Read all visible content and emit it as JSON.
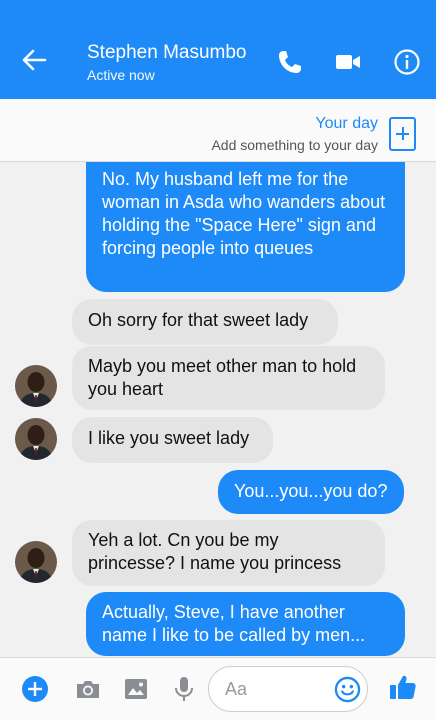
{
  "header": {
    "contact_name": "Stephen Masumbo",
    "status": "Active now"
  },
  "your_day": {
    "title": "Your day",
    "subtitle": "Add something to your day"
  },
  "messages": [
    {
      "sender": "me",
      "text": "No. My husband left me for the woman in Asda who wanders about holding the \"Space Here\" sign and forcing people into queues"
    },
    {
      "sender": "them",
      "text": "Oh sorry for that sweet lady"
    },
    {
      "sender": "them",
      "text": "Mayb you meet other man to hold you heart"
    },
    {
      "sender": "them",
      "text": "I like you sweet lady"
    },
    {
      "sender": "me",
      "text": "You...you...you do?"
    },
    {
      "sender": "them",
      "text": "Yeh a lot. Cn you be my princesse? I name you princess"
    },
    {
      "sender": "me",
      "text": "Actually, Steve, I have another name I like to be called by men..."
    }
  ],
  "composer": {
    "placeholder": "Aa"
  },
  "colors": {
    "accent": "#1e8af7",
    "incoming_bubble": "#e4e4e4",
    "background": "#f1f1f1"
  },
  "icons": [
    "back-arrow-icon",
    "phone-icon",
    "video-camera-icon",
    "info-icon",
    "add-story-icon",
    "plus-icon",
    "camera-icon",
    "gallery-icon",
    "microphone-icon",
    "emoji-icon",
    "like-icon"
  ]
}
